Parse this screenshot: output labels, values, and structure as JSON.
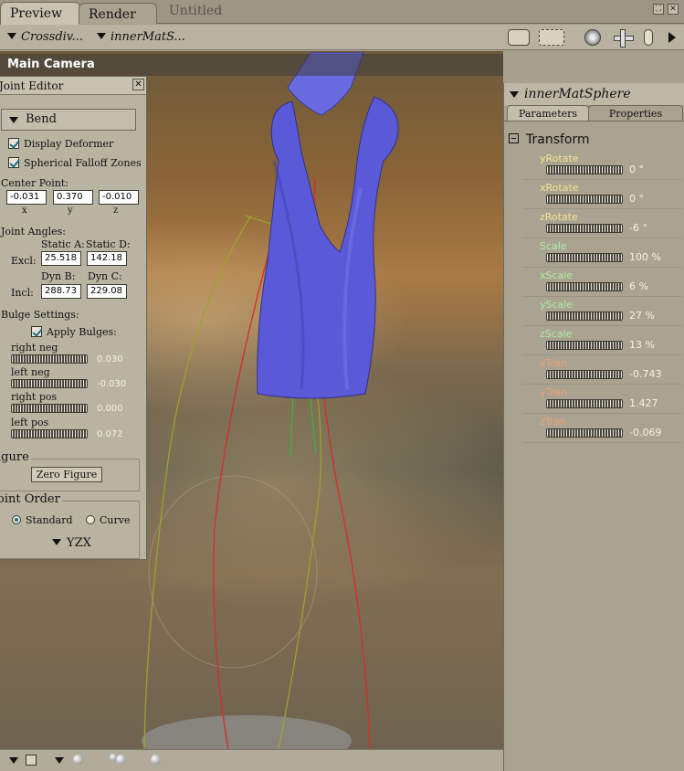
{
  "tabs": {
    "preview": "Preview",
    "render": "Render"
  },
  "document_title": "Untitled",
  "window_controls": {
    "expand": "⛶",
    "close": "✕"
  },
  "menus": {
    "camera_menu": "Crossdiv...",
    "actor_menu": "innerMatS..."
  },
  "viewport": {
    "camera_label": "Main Camera"
  },
  "joint_editor": {
    "title": "Joint Editor",
    "close": "✕",
    "bend_label": "Bend",
    "display_deformer": {
      "label": "Display Deformer",
      "checked": true
    },
    "spherical_falloff": {
      "label": "Spherical Falloff Zones",
      "checked": true
    },
    "center_point_label": "Center Point:",
    "center": {
      "x": "-0.031",
      "y": "0.370",
      "z": "-0.010"
    },
    "axis": {
      "x": "x",
      "y": "y",
      "z": "z"
    },
    "joint_angles_label": "Joint Angles:",
    "static_a_label": "Static A:",
    "static_d_label": "Static D:",
    "excl_label": "Excl:",
    "static_a": "25.518",
    "static_d": "142.18",
    "dyn_b_label": "Dyn B:",
    "dyn_c_label": "Dyn C:",
    "incl_label": "Incl:",
    "dyn_b": "288.73",
    "dyn_c": "229.08",
    "bulge_label": "Bulge Settings:",
    "apply_bulges": {
      "label": "Apply Bulges:",
      "checked": true
    },
    "bulges": [
      {
        "label": "right neg",
        "value": "0.030"
      },
      {
        "label": "left neg",
        "value": "-0.030"
      },
      {
        "label": "right pos",
        "value": "0.000"
      },
      {
        "label": "left pos",
        "value": "0.072"
      }
    ],
    "figure_section": "igure",
    "zero_figure": "Zero Figure",
    "joint_order_section": "oint Order",
    "order_standard": "Standard",
    "order_curve": "Curve",
    "order_value": "YZX"
  },
  "param_panel": {
    "actor": "innerMatSphere",
    "tab_parameters": "Parameters",
    "tab_properties": "Properties",
    "group": "Transform",
    "params": [
      {
        "name": "yRotate",
        "value": "0 °",
        "color": "#f0e68c"
      },
      {
        "name": "xRotate",
        "value": "0 °",
        "color": "#f0e68c"
      },
      {
        "name": "zRotate",
        "value": "-6 °",
        "color": "#f0e68c"
      },
      {
        "name": "Scale",
        "value": "100 %",
        "color": "#a8f0a0"
      },
      {
        "name": "xScale",
        "value": "6 %",
        "color": "#a8f0a0"
      },
      {
        "name": "yScale",
        "value": "27 %",
        "color": "#a8f0a0"
      },
      {
        "name": "zScale",
        "value": "13 %",
        "color": "#a8f0a0"
      },
      {
        "name": "xTran",
        "value": "-0.743",
        "color": "#f0a070"
      },
      {
        "name": "yTran",
        "value": "1.427",
        "color": "#f0a070"
      },
      {
        "name": "zTran",
        "value": "-0.069",
        "color": "#f0a070"
      }
    ]
  },
  "colors": {
    "dress": "#5a5ad8",
    "bone_red": "#d03030",
    "bone_green": "#40b040",
    "falloff_yellow": "#a0a030"
  }
}
